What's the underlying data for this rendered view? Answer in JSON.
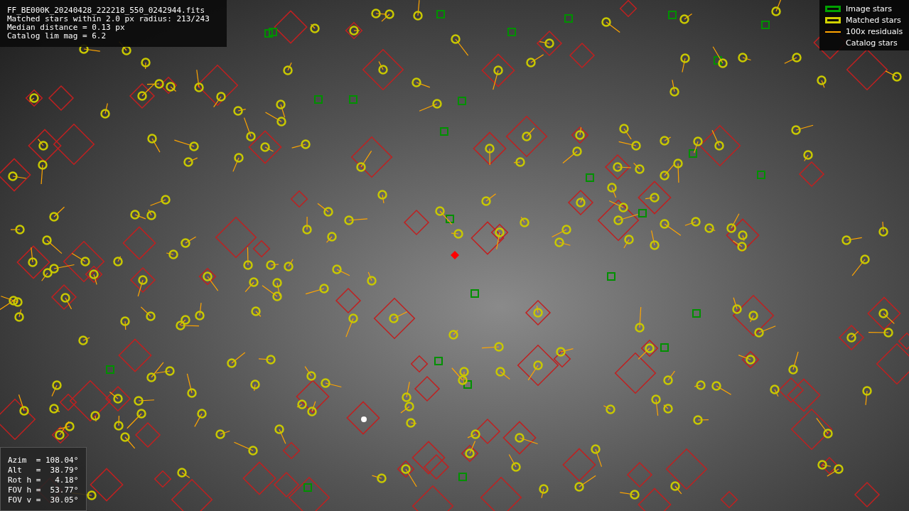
{
  "info_lines": [
    "FF_BE000K_20240428_222218_550_0242944.fits",
    "Matched stars within 2.0 px radius: 213/243",
    "Median distance = 0.13 px",
    "Catalog lim mag = 6.2"
  ],
  "legend": [
    {
      "kind": "box",
      "color": "#00a000",
      "label": "Image stars"
    },
    {
      "kind": "box",
      "color": "#d0d000",
      "label": "Matched stars"
    },
    {
      "kind": "line",
      "color": "#ffa500",
      "label": "100x residuals"
    },
    {
      "kind": "none",
      "label": "Catalog stars"
    }
  ],
  "pointing_lines": [
    "Azim  = 108.04°",
    "Alt   =  38.79°",
    "Rot h =   4.18°",
    "FOV h =  53.77°",
    "FOV v =  30.05°"
  ]
}
